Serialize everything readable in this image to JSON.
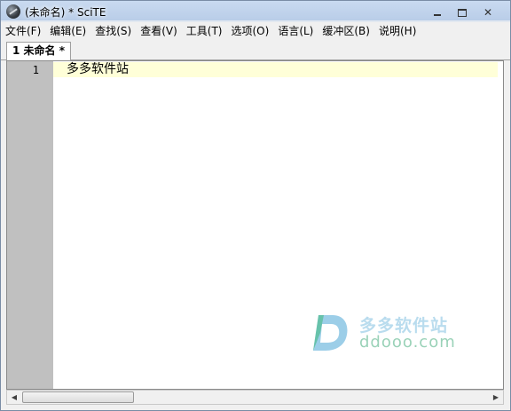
{
  "window": {
    "title": "(未命名) * SciTE",
    "icon": "scite-app-icon"
  },
  "menubar": {
    "items": [
      {
        "label": "文件(F)"
      },
      {
        "label": "编辑(E)"
      },
      {
        "label": "查找(S)"
      },
      {
        "label": "查看(V)"
      },
      {
        "label": "工具(T)"
      },
      {
        "label": "选项(O)"
      },
      {
        "label": "语言(L)"
      },
      {
        "label": "缓冲区(B)"
      },
      {
        "label": "说明(H)"
      }
    ]
  },
  "tabs": [
    {
      "label": "1 未命名 *",
      "active": true
    }
  ],
  "editor": {
    "line_number": "1",
    "line_text": "多多软件站",
    "caret_line_color": "#ffffd8",
    "gutter_color": "#c0c0c0"
  },
  "watermark": {
    "name": "多多软件站",
    "domain": "ddooo.com",
    "colors": {
      "blue": "#4aa6d6",
      "green": "#3cb878"
    }
  },
  "scrollbar": {
    "left_arrow": "◀",
    "right_arrow": "▶"
  }
}
